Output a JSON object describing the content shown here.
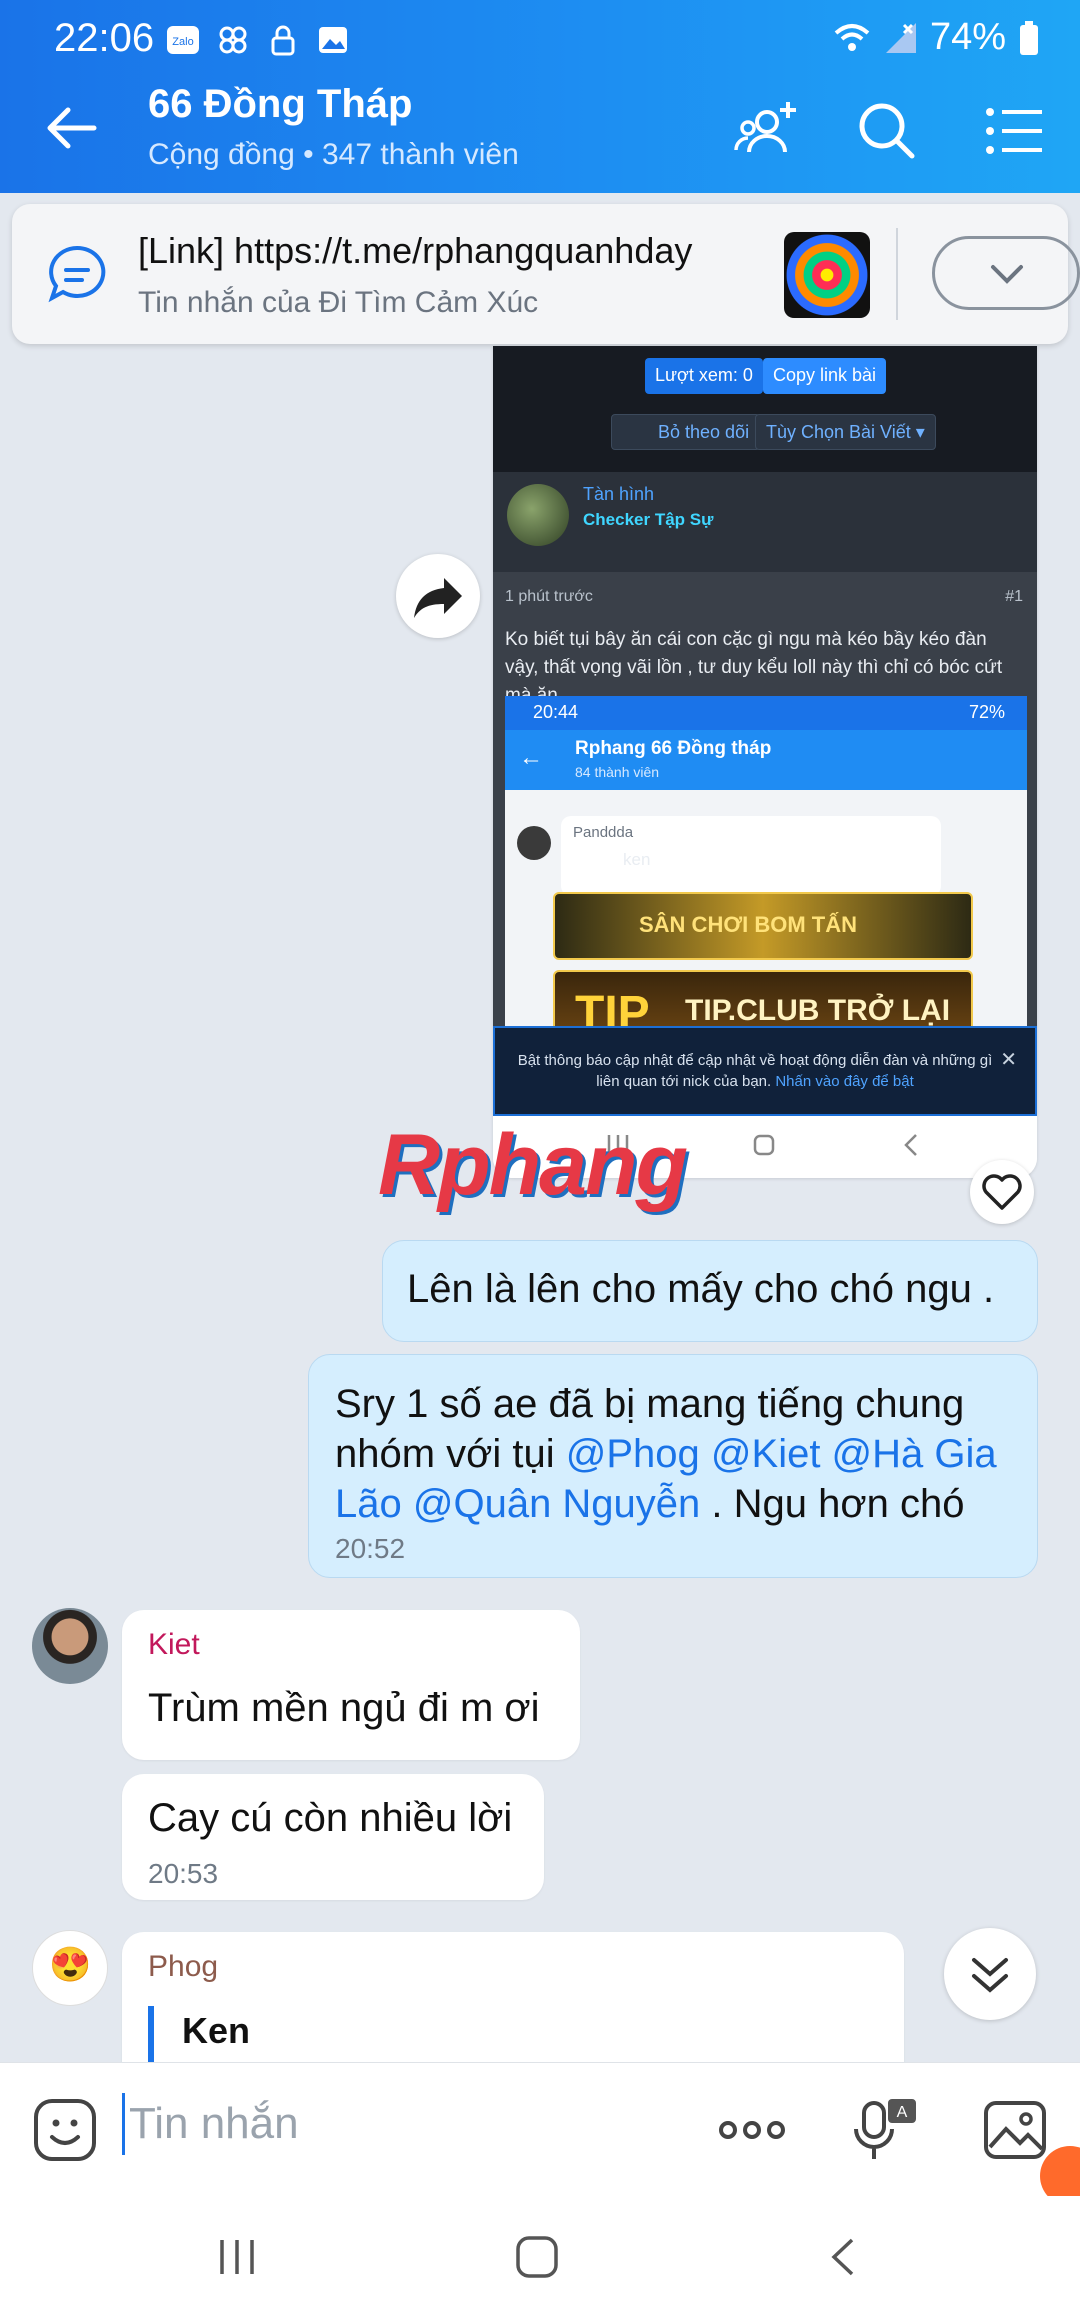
{
  "status_bar": {
    "time": "22:06",
    "battery": "74%"
  },
  "header": {
    "title": "66 Đồng Tháp",
    "subtitle": "Cộng đồng • 347 thành viên"
  },
  "pinned": {
    "title": "[Link] https://t.me/rphangquanhday",
    "subtitle": "Tin nhắn của Đi Tìm Cảm Xúc"
  },
  "shared_image": {
    "views_btn": "Lượt xem: 0",
    "copy_btn": "Copy link bài",
    "unfollow_btn": "Bỏ theo dõi",
    "options_btn": "Tùy Chọn Bài Viết ▾",
    "username": "Tàn hình",
    "role": "Checker Tập Sự",
    "time_ago": "1 phút trước",
    "post_num": "#1",
    "post_text": "Ko biết tụi bây ăn cái con cặc gì ngu mà kéo bầy kéo đàn vậy, thất vọng vãi lồn , tư duy kểu loll này thì chỉ có bóc cứt mà ăn.",
    "inner_time": "20:44",
    "inner_battery": "72%",
    "inner_title": "Rphang 66 Đồng tháp",
    "inner_members": "84 thành viên",
    "inner_sender": "Panddda",
    "inner_reply": "ken",
    "banner1": "SÂN CHƠI BOM TẤN",
    "banner2": "TIP.CLUB TRỞ LẠI",
    "notice": "Bật thông báo cập nhật để cập nhật về hoạt động diễn đàn và những gì liên quan tới nick của bạn.",
    "notice_link": "Nhấn vào đây để bật"
  },
  "watermark": "Rphang",
  "messages": {
    "m1": "Lên là lên cho mấy cho chó ngu .",
    "m2_pre": "Sry 1 số ae đã bị mang tiếng chung nhóm với tụi ",
    "m2_mentions": "@Phog @Kiet @Hà Gia Lão @Quân Nguyễn",
    "m2_post": " . Ngu hơn chó",
    "m2_time": "20:52",
    "kiet_name": "Kiet",
    "kiet_msg1": "Trùm mền ngủ đi m ơi",
    "kiet_msg2": "Cay cú còn nhiều lời",
    "kiet_time": "20:53",
    "phog_name": "Phog",
    "phog_quote": "Ken"
  },
  "composer": {
    "placeholder": "Tin nhắn"
  },
  "colors": {
    "header_blue": "#1a73e8",
    "my_bubble": "#d5eefe",
    "mention": "#1a73e8",
    "kiet_name": "#c2185b",
    "phog_name": "#8d5b4c"
  }
}
